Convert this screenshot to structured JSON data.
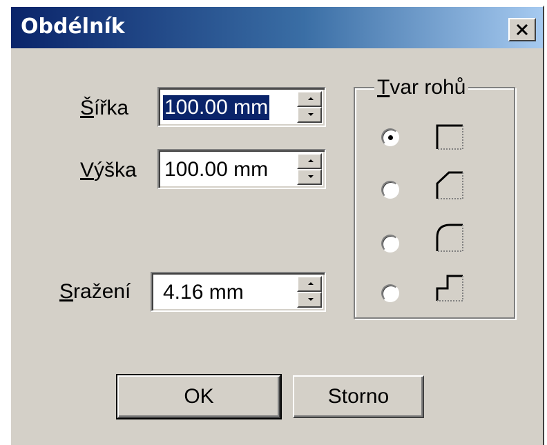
{
  "window": {
    "title": "Obdélník",
    "close_icon": "close-icon"
  },
  "fields": {
    "width": {
      "label_accel": "Š",
      "label_rest": "ířka",
      "value": "100.00 mm",
      "selected": true
    },
    "height": {
      "label_accel": "V",
      "label_rest": "ýška",
      "value": "100.00 mm"
    },
    "chamfer": {
      "label_accel": "S",
      "label_rest": "ražení",
      "value": "4.16 mm"
    }
  },
  "corner_shape": {
    "legend_accel": "T",
    "legend_rest": "var rohů",
    "selected_index": 0,
    "options": [
      {
        "icon": "square-corner-icon"
      },
      {
        "icon": "chamfered-corner-icon"
      },
      {
        "icon": "rounded-corner-icon"
      },
      {
        "icon": "notched-corner-icon"
      }
    ]
  },
  "buttons": {
    "ok": "OK",
    "cancel": "Storno"
  }
}
